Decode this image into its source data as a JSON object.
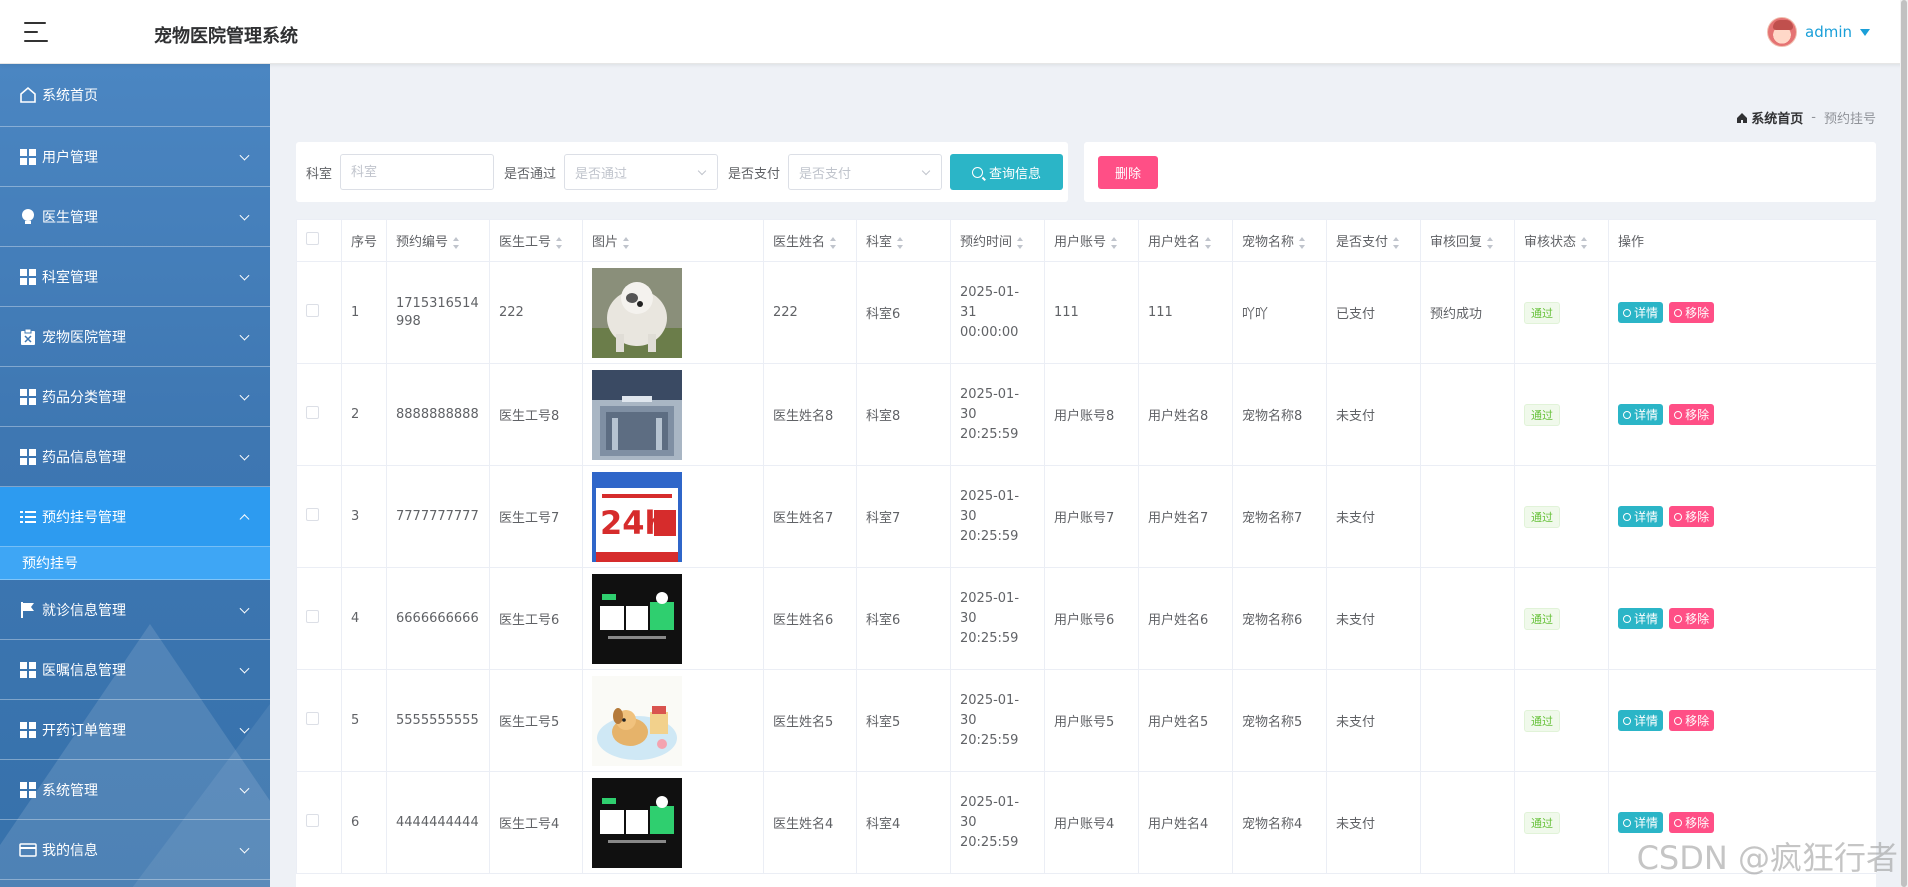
{
  "header": {
    "title": "宠物医院管理系统",
    "user": "admin"
  },
  "sidebar": {
    "items": [
      {
        "label": "系统首页",
        "icon": "home-icon"
      },
      {
        "label": "用户管理",
        "icon": "grid-icon"
      },
      {
        "label": "医生管理",
        "icon": "bulb-icon"
      },
      {
        "label": "科室管理",
        "icon": "grid-icon"
      },
      {
        "label": "宠物医院管理",
        "icon": "clipboard-icon"
      },
      {
        "label": "药品分类管理",
        "icon": "grid-icon"
      },
      {
        "label": "药品信息管理",
        "icon": "grid-icon"
      },
      {
        "label": "预约挂号管理",
        "icon": "list-icon"
      },
      {
        "label": "就诊信息管理",
        "icon": "flag-icon"
      },
      {
        "label": "医嘱信息管理",
        "icon": "grid-icon"
      },
      {
        "label": "开药订单管理",
        "icon": "grid-icon"
      },
      {
        "label": "系统管理",
        "icon": "grid-icon"
      },
      {
        "label": "我的信息",
        "icon": "card-icon"
      }
    ],
    "submenu": {
      "label": "预约挂号"
    }
  },
  "breadcrumb": {
    "home": "系统首页",
    "separator": "-",
    "current": "预约挂号"
  },
  "search": {
    "dept_label": "科室",
    "dept_placeholder": "科室",
    "pass_label": "是否通过",
    "pass_placeholder": "是否通过",
    "paid_label": "是否支付",
    "paid_placeholder": "是否支付",
    "query_button": "查询信息"
  },
  "actions": {
    "delete_button": "删除"
  },
  "table": {
    "headers": [
      "序号",
      "预约编号",
      "医生工号",
      "图片",
      "医生姓名",
      "科室",
      "预约时间",
      "用户账号",
      "用户姓名",
      "宠物名称",
      "是否支付",
      "审核回复",
      "审核状态",
      "操作"
    ],
    "detail_label": "详情",
    "remove_label": "移除",
    "rows": [
      {
        "idx": "1",
        "code": "1715316514998",
        "doc_no": "222",
        "img": "sheepdog-photo",
        "doc_name": "222",
        "dept": "科室6",
        "date": "2025-01-31",
        "time": "00:00:00",
        "account": "111",
        "user_name": "111",
        "pet": "吖吖",
        "paid": "已支付",
        "reply": "预约成功",
        "status": "通过"
      },
      {
        "idx": "2",
        "code": "8888888888",
        "doc_no": "医生工号8",
        "img": "hospital-photo",
        "doc_name": "医生姓名8",
        "dept": "科室8",
        "date": "2025-01-30",
        "time": "20:25:59",
        "account": "用户账号8",
        "user_name": "用户姓名8",
        "pet": "宠物名称8",
        "paid": "未支付",
        "reply": "",
        "status": "通过"
      },
      {
        "idx": "3",
        "code": "7777777777",
        "doc_no": "医生工号7",
        "img": "poster-24h",
        "doc_name": "医生姓名7",
        "dept": "科室7",
        "date": "2025-01-30",
        "time": "20:25:59",
        "account": "用户账号7",
        "user_name": "用户姓名7",
        "pet": "宠物名称7",
        "paid": "未支付",
        "reply": "",
        "status": "通过"
      },
      {
        "idx": "4",
        "code": "6666666666",
        "doc_no": "医生工号6",
        "img": "pet-hospital-logo",
        "doc_name": "医生姓名6",
        "dept": "科室6",
        "date": "2025-01-30",
        "time": "20:25:59",
        "account": "用户账号6",
        "user_name": "用户姓名6",
        "pet": "宠物名称6",
        "paid": "未支付",
        "reply": "",
        "status": "通过"
      },
      {
        "idx": "5",
        "code": "5555555555",
        "doc_no": "医生工号5",
        "img": "cartoon-dog",
        "doc_name": "医生姓名5",
        "dept": "科室5",
        "date": "2025-01-30",
        "time": "20:25:59",
        "account": "用户账号5",
        "user_name": "用户姓名5",
        "pet": "宠物名称5",
        "paid": "未支付",
        "reply": "",
        "status": "通过"
      },
      {
        "idx": "6",
        "code": "4444444444",
        "doc_no": "医生工号4",
        "img": "pet-hospital-logo",
        "doc_name": "医生姓名4",
        "dept": "科室4",
        "date": "2025-01-30",
        "time": "20:25:59",
        "account": "用户账号4",
        "user_name": "用户姓名4",
        "pet": "宠物名称4",
        "paid": "未支付",
        "reply": "",
        "status": "通过"
      }
    ]
  },
  "watermark": "CSDN @疯狂行者",
  "colors": {
    "accent": "#2bb5c7",
    "danger": "#ff4f86",
    "sidebar": "#3e77b2",
    "active": "#2d9bf0",
    "link": "#1a9fd8"
  }
}
